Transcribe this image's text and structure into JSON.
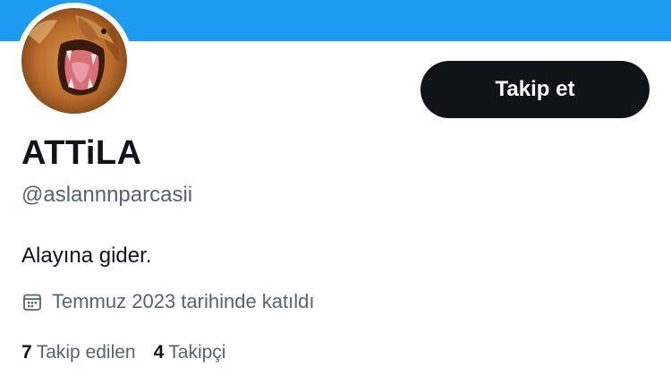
{
  "colors": {
    "banner": "#1d9bf0",
    "button_bg": "#0f1419",
    "secondary_text": "#536471"
  },
  "profile": {
    "display_name": "ATTiLA",
    "handle": "@aslannnparcasii",
    "bio": "Alayına gider.",
    "joined_text": "Temmuz 2023 tarihinde katıldı",
    "joined_icon": "calendar-icon",
    "avatar_description": "roaring-lion-avatar"
  },
  "actions": {
    "follow_label": "Takip et"
  },
  "stats": {
    "following_count": "7",
    "following_label": "Takip edilen",
    "followers_count": "4",
    "followers_label": "Takipçi"
  }
}
